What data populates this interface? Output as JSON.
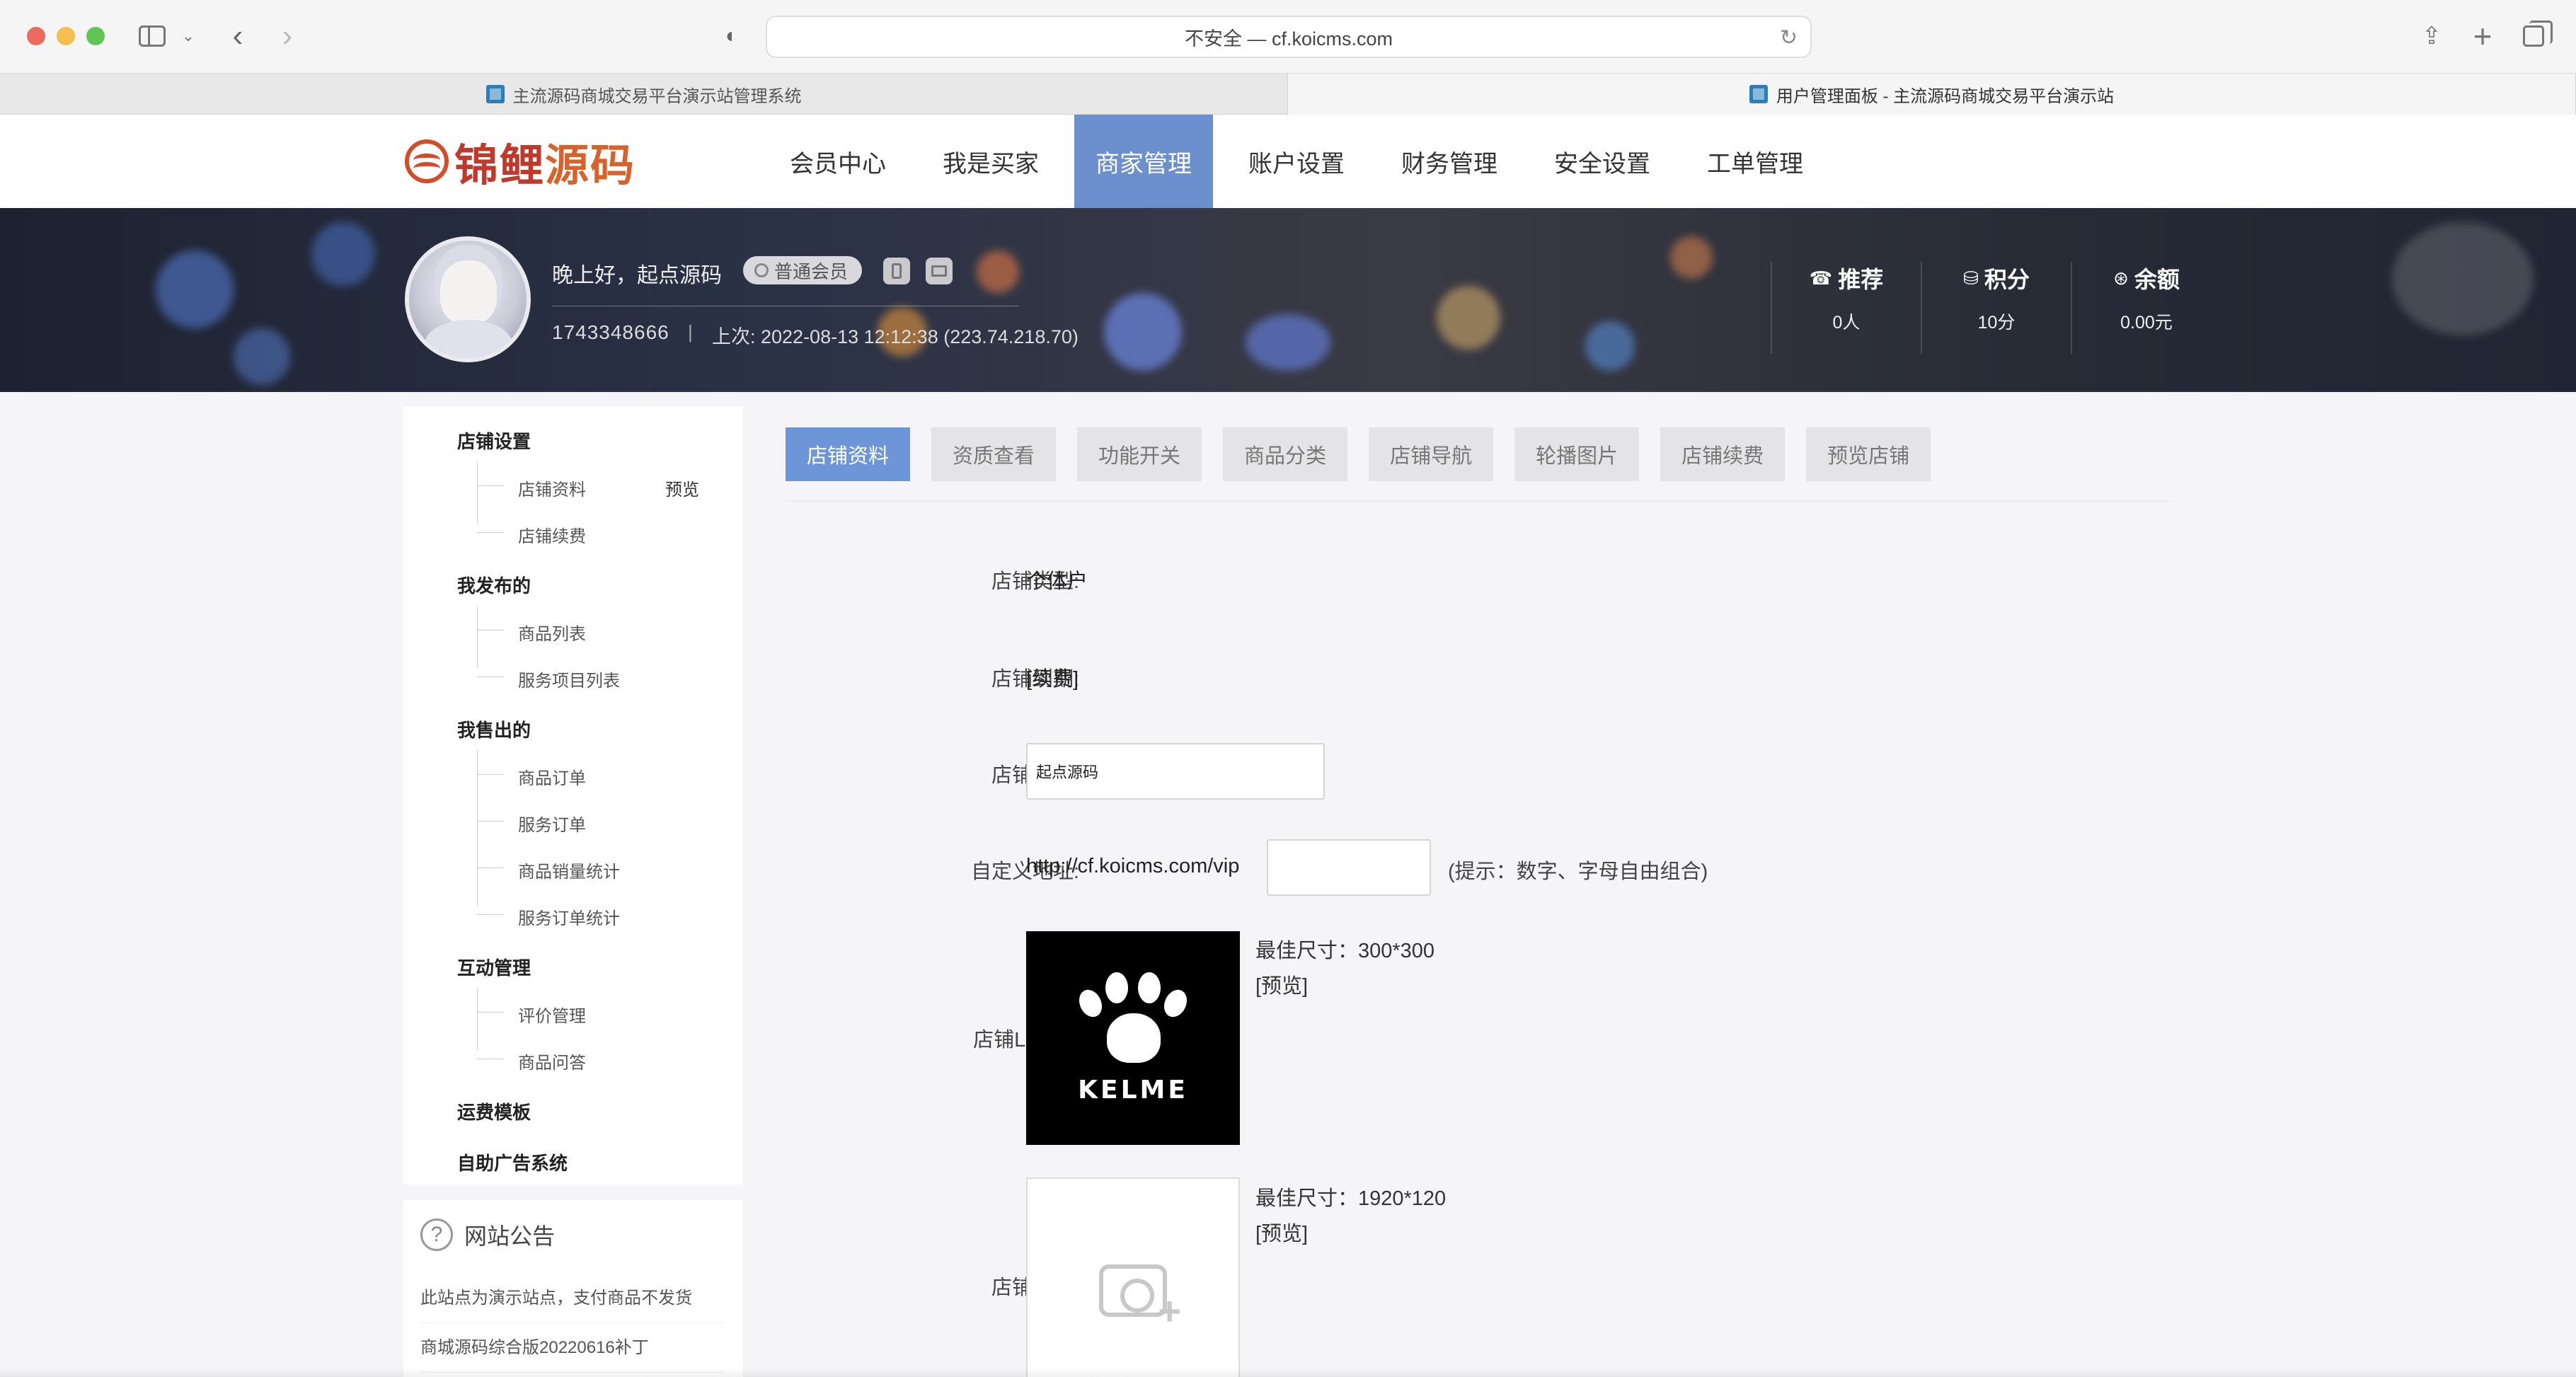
{
  "browser": {
    "address": "不安全 — cf.koicms.com",
    "tabs": [
      {
        "title": "主流源码商城交易平台演示站管理系统",
        "active": false
      },
      {
        "title": "用户管理面板 - 主流源码商城交易平台演示站",
        "active": true
      }
    ]
  },
  "site": {
    "logo_text_a": "锦鲤",
    "logo_text_b": "源码",
    "nav": [
      "会员中心",
      "我是买家",
      "商家管理",
      "账户设置",
      "财务管理",
      "安全设置",
      "工单管理"
    ],
    "nav_active_index": 2,
    "accent_color": "#6c8fce"
  },
  "user": {
    "greeting": "晚上好，起点源码",
    "member_level": "普通会员",
    "user_id": "1743348666",
    "separator": "|",
    "last_login": "上次: 2022-08-13 12:12:38 (223.74.218.70)",
    "stats": [
      {
        "label": "推荐",
        "value": "0人",
        "icon": "☎"
      },
      {
        "label": "积分",
        "value": "10分",
        "icon": "⛁"
      },
      {
        "label": "余额",
        "value": "0.00元",
        "icon": "⊛"
      }
    ]
  },
  "sidebar": {
    "groups": [
      {
        "title": "店铺设置",
        "items": [
          "店铺资料",
          "店铺续费"
        ]
      },
      {
        "title": "我发布的",
        "items": [
          "商品列表",
          "服务项目列表"
        ]
      },
      {
        "title": "我售出的",
        "items": [
          "商品订单",
          "服务订单",
          "商品销量统计",
          "服务订单统计"
        ]
      },
      {
        "title": "互动管理",
        "items": [
          "评价管理",
          "商品问答"
        ]
      },
      {
        "title": "运费模板",
        "items": []
      },
      {
        "title": "自助广告系统",
        "items": []
      }
    ],
    "preview_link": "预览"
  },
  "notice": {
    "title": "网站公告",
    "items": [
      "此站点为演示站点，支付商品不发货",
      "商城源码综合版20220616补丁"
    ]
  },
  "store_tabs": [
    "店铺资料",
    "资质查看",
    "功能开关",
    "商品分类",
    "店铺导航",
    "轮播图片",
    "店铺续费",
    "预览店铺"
  ],
  "store_tabs_active_index": 0,
  "form": {
    "type_label": "店铺类型:",
    "type_value": "个体户",
    "expire_label": "店铺到期:",
    "expire_value": "[续费]",
    "name_label": "店铺名称:",
    "name_value": "起点源码",
    "url_label": "自定义地址:",
    "url_prefix": "http://cf.koicms.com/vip",
    "url_value": "",
    "url_hint": "(提示：数字、字母自由组合)",
    "logo_label": "店铺LOGO:",
    "logo_size": "最佳尺寸：300*300",
    "logo_preview": "[预览]",
    "logo_brand_text": "KELME",
    "banner_label": "店铺横幅:",
    "banner_size": "最佳尺寸：1920*120",
    "banner_preview": "[预览]"
  }
}
